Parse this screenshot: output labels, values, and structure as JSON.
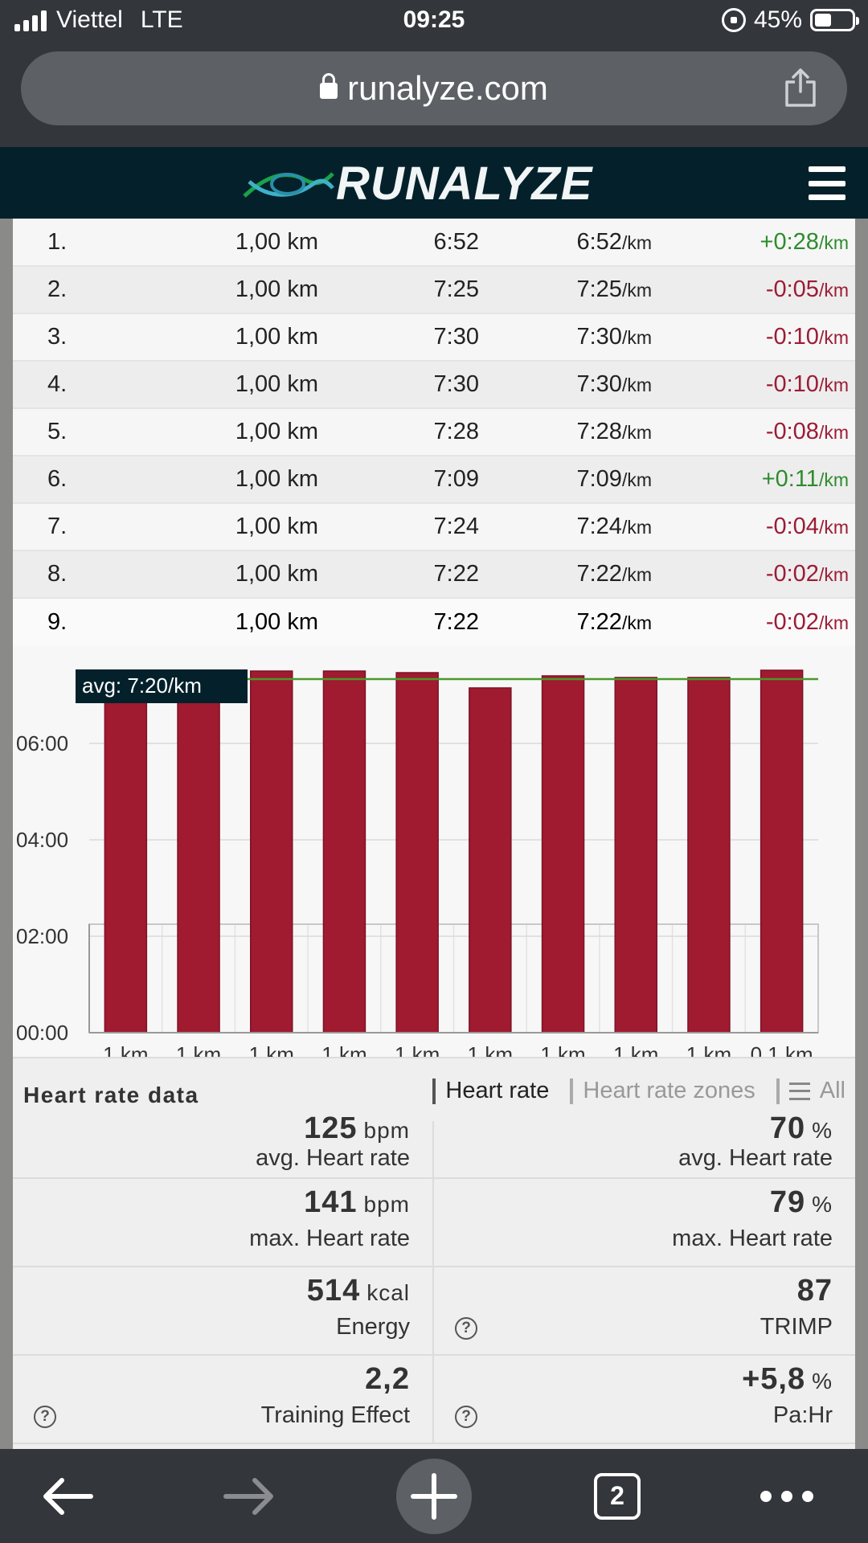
{
  "status_bar": {
    "carrier": "Viettel",
    "network": "LTE",
    "time": "09:25",
    "battery": "45%",
    "battery_level": 0.45
  },
  "browser": {
    "url": "runalyze.com"
  },
  "site": {
    "logo_text": "RUNALYZE"
  },
  "splits": {
    "unit_km": "/km",
    "rows": [
      {
        "num": "1.",
        "distance": "1,00 km",
        "time": "6:52",
        "pace": "6:52",
        "diff": "+0:28",
        "positive": true
      },
      {
        "num": "2.",
        "distance": "1,00 km",
        "time": "7:25",
        "pace": "7:25",
        "diff": "-0:05",
        "positive": false
      },
      {
        "num": "3.",
        "distance": "1,00 km",
        "time": "7:30",
        "pace": "7:30",
        "diff": "-0:10",
        "positive": false
      },
      {
        "num": "4.",
        "distance": "1,00 km",
        "time": "7:30",
        "pace": "7:30",
        "diff": "-0:10",
        "positive": false
      },
      {
        "num": "5.",
        "distance": "1,00 km",
        "time": "7:28",
        "pace": "7:28",
        "diff": "-0:08",
        "positive": false
      },
      {
        "num": "6.",
        "distance": "1,00 km",
        "time": "7:09",
        "pace": "7:09",
        "diff": "+0:11",
        "positive": true
      },
      {
        "num": "7.",
        "distance": "1,00 km",
        "time": "7:24",
        "pace": "7:24",
        "diff": "-0:04",
        "positive": false
      },
      {
        "num": "8.",
        "distance": "1,00 km",
        "time": "7:22",
        "pace": "7:22",
        "diff": "-0:02",
        "positive": false
      },
      {
        "num": "9.",
        "distance": "1,00 km",
        "time": "7:22",
        "pace": "7:22",
        "diff": "-0:02",
        "positive": false
      }
    ]
  },
  "chart_data": {
    "type": "bar",
    "categories": [
      "1 km",
      "1 km",
      "1 km",
      "1 km",
      "1 km",
      "1 km",
      "1 km",
      "1 km",
      "1 km",
      "0.1 km"
    ],
    "values_seconds": [
      412,
      445,
      450,
      450,
      448,
      429,
      444,
      442,
      442,
      451
    ],
    "y_ticks": [
      "00:00",
      "02:00",
      "04:00",
      "06:00"
    ],
    "ylim_seconds": [
      0,
      480
    ],
    "avg_line_seconds": 440,
    "avg_label": "avg: 7:20/km",
    "bar_color": "#a01a30",
    "avg_line_color": "#4a9a2a",
    "grid": true
  },
  "heart_rate": {
    "title": "Heart rate data",
    "tabs": [
      {
        "label": "Heart rate",
        "active": true
      },
      {
        "label": "Heart rate zones",
        "active": false
      },
      {
        "label": "All",
        "active": false
      }
    ],
    "rows": [
      {
        "left": {
          "value": "125",
          "unit": "bpm",
          "label": "avg. Heart rate",
          "help": false
        },
        "right": {
          "value": "70",
          "unit": "%",
          "label": "avg. Heart rate",
          "help": false
        }
      },
      {
        "left": {
          "value": "141",
          "unit": "bpm",
          "label": "max. Heart rate",
          "help": false
        },
        "right": {
          "value": "79",
          "unit": "%",
          "label": "max. Heart rate",
          "help": false
        }
      },
      {
        "left": {
          "value": "514",
          "unit": "kcal",
          "label": "Energy",
          "help": false
        },
        "right": {
          "value": "87",
          "unit": "",
          "label": "TRIMP",
          "help": true
        }
      },
      {
        "left": {
          "value": "2,2",
          "unit": "",
          "label": "Training Effect",
          "help": true
        },
        "right": {
          "value": "+5,8",
          "unit": "%",
          "label": "Pa:Hr",
          "help": true
        }
      }
    ],
    "help_glyph": "?"
  },
  "toolbar": {
    "tab_count": "2"
  }
}
